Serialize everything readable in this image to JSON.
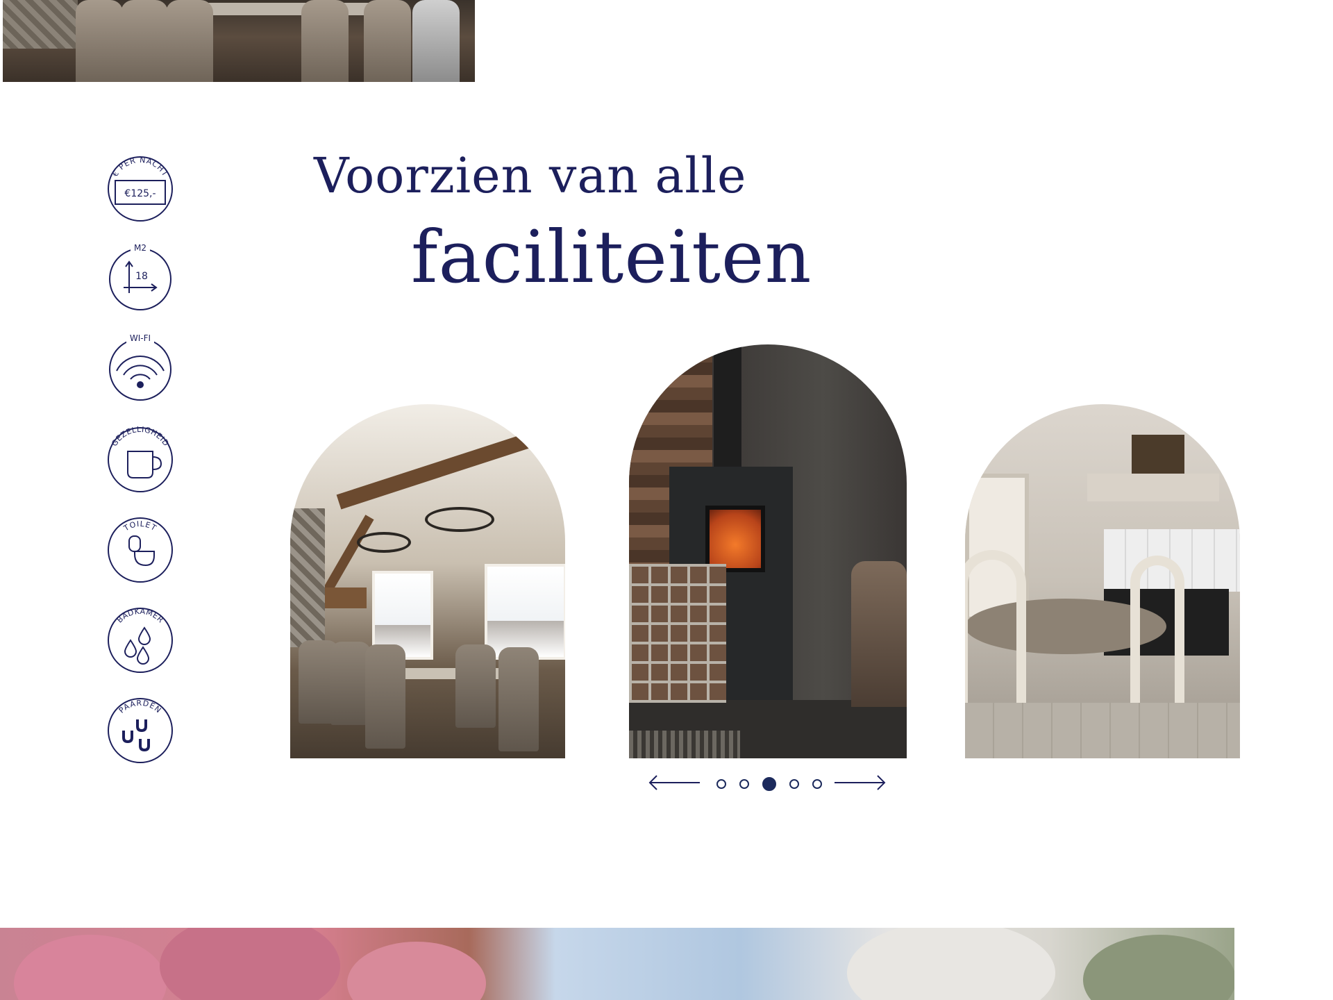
{
  "heading": {
    "line1": "Voorzien van alle",
    "line2": "faciliteiten"
  },
  "amenities": [
    {
      "label": "€ PER NACHT",
      "value": "€125,-",
      "icon": "price-tag-icon"
    },
    {
      "label": "M2",
      "value": "18",
      "icon": "area-axes-icon"
    },
    {
      "label": "WI-FI",
      "value": "",
      "icon": "wifi-icon"
    },
    {
      "label": "GEZELLIGHEID",
      "value": "",
      "icon": "mug-icon"
    },
    {
      "label": "TOILET",
      "value": "",
      "icon": "toilet-icon"
    },
    {
      "label": "BADKAMER",
      "value": "",
      "icon": "water-drops-icon"
    },
    {
      "label": "PAARDEN",
      "value": "",
      "icon": "horseshoe-icon"
    }
  ],
  "gallery": {
    "slides": [
      {
        "subject": "dining room with chandeliers and snowy mountain view"
      },
      {
        "subject": "wood stove with firewood basket"
      },
      {
        "subject": "country kitchen with round table"
      }
    ],
    "dots_count": 5,
    "active_dot": 3,
    "prev_icon": "arrow-left-icon",
    "next_icon": "arrow-right-icon"
  },
  "colors": {
    "navy": "#1c1f5c",
    "dot": "#1c2a5c",
    "background": "#ffffff"
  }
}
